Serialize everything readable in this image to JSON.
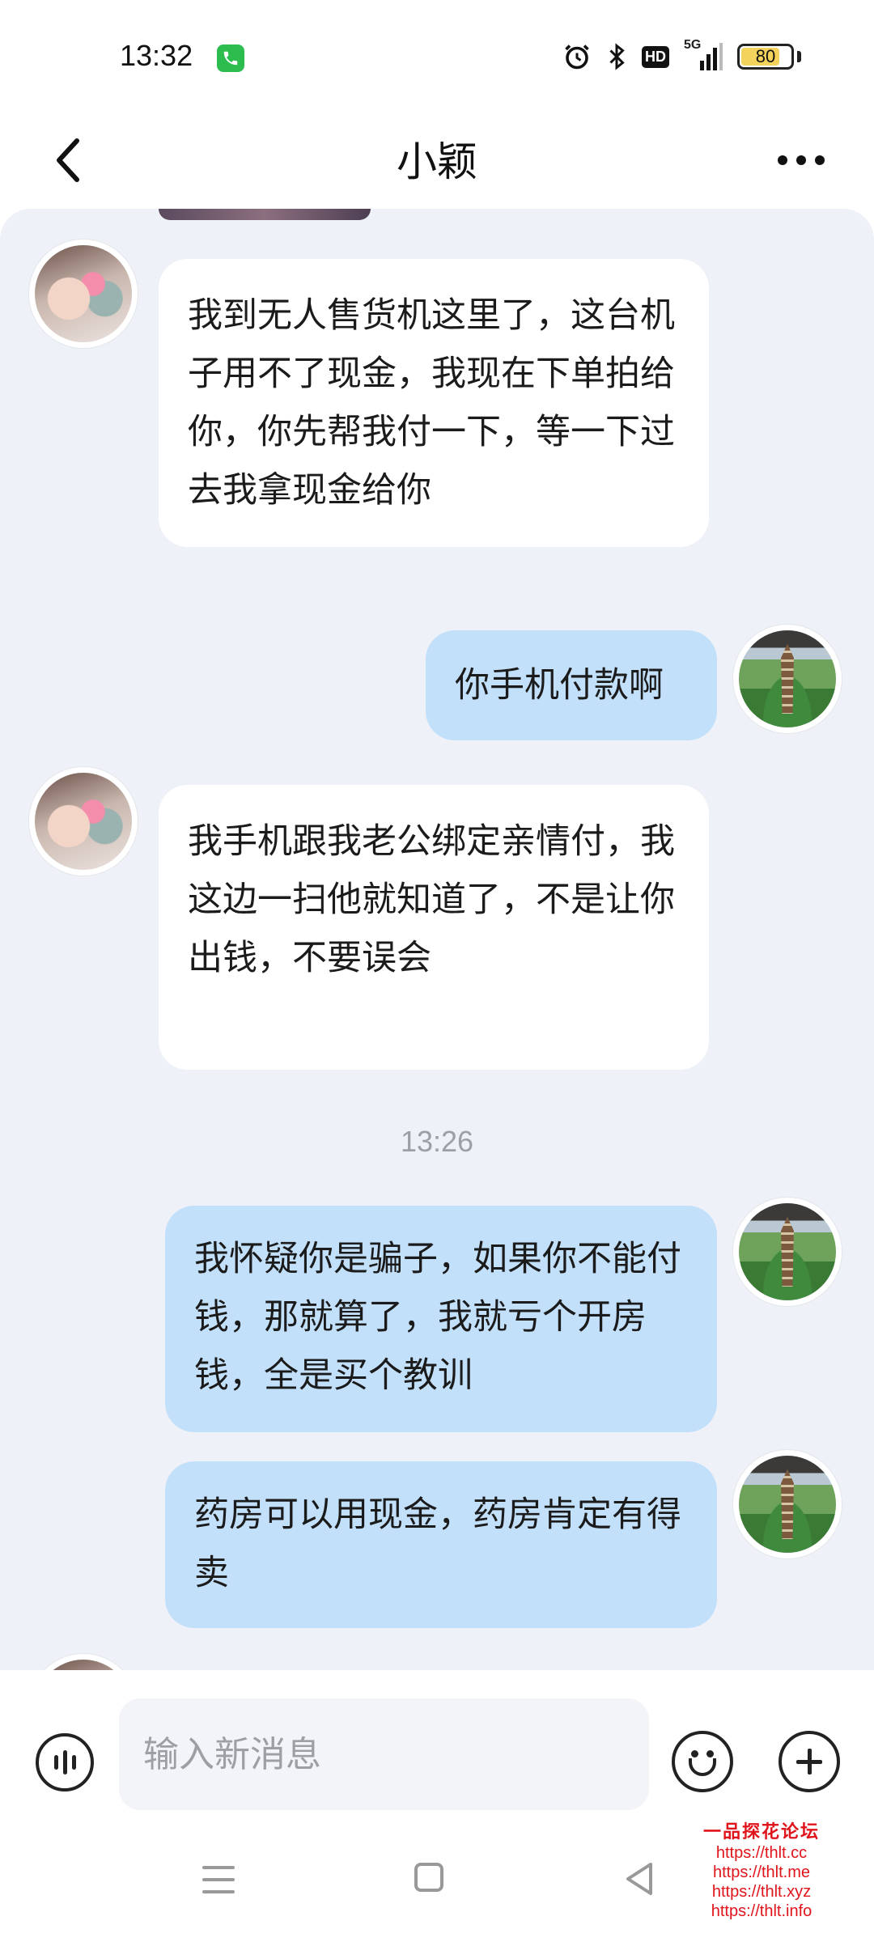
{
  "status_bar": {
    "time": "13:32",
    "network": "5G",
    "hd": "HD",
    "battery": "80",
    "battery_level_percent": 80
  },
  "header": {
    "title": "小颖",
    "back_icon": "chevron-left-icon",
    "more_icon": "more-horizontal-icon"
  },
  "messages": [
    {
      "from": "contact",
      "text": "我到无人售货机这里了，这台机子用不了现金，我现在下单拍给你，你先帮我付一下，等一下过去我拿现金给你"
    },
    {
      "from": "me",
      "text": "你手机付款啊"
    },
    {
      "from": "contact",
      "text": "我手机跟我老公绑定亲情付，我这边一扫他就知道了，不是让你出钱，不要误会"
    },
    {
      "from": "me",
      "text": "我怀疑你是骗子，如果你不能付钱，那就算了，我就亏个开房钱，全是买个教训"
    },
    {
      "from": "me",
      "text": "药房可以用现金，药房肯定有得卖"
    }
  ],
  "timestamp": "13:26",
  "input_bar": {
    "placeholder": "输入新消息",
    "voice_icon": "voice-icon",
    "emoji_icon": "emoji-icon",
    "plus_icon": "plus-circle-icon"
  },
  "watermark": {
    "title": "一品探花论坛",
    "lines": [
      "https://thlt.cc",
      "https://thlt.me",
      "https://thlt.xyz",
      "https://thlt.info"
    ]
  },
  "colors": {
    "chat_background": "#eef2f8",
    "incoming_bubble": "#ffffff",
    "outgoing_bubble": "#c3e0fb",
    "watermark": "#e0141b"
  }
}
